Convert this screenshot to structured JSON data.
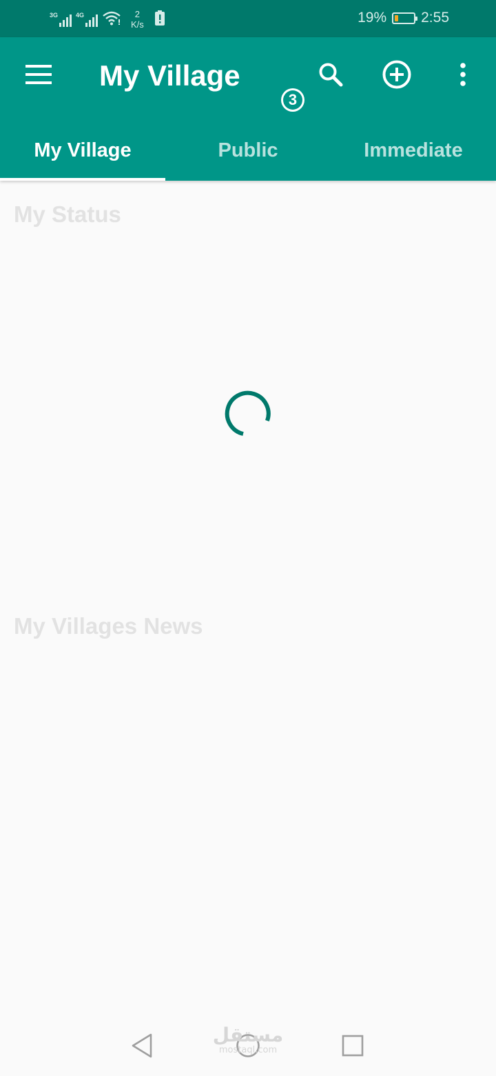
{
  "status_bar": {
    "net1": "3G",
    "net2": "4G",
    "speed_value": "2",
    "speed_unit": "K/s",
    "battery_percent": "19%",
    "battery_level": 0.19,
    "time": "2:55"
  },
  "toolbar": {
    "title": "My Village",
    "menu_icon": "hamburger-menu-icon",
    "search_icon": "search-icon",
    "add_icon": "add-circle-icon",
    "more_icon": "more-vert-icon"
  },
  "tabs": [
    {
      "label": "My Village",
      "active": true
    },
    {
      "label": "Public",
      "active": false,
      "badge": "3"
    },
    {
      "label": "Immediate",
      "active": false
    }
  ],
  "content": {
    "status_heading": "My Status",
    "news_heading": "My Villages News"
  },
  "watermark": {
    "arabic": "مستقل",
    "latin": "mostaql.com"
  },
  "colors": {
    "status_bar": "#00796b",
    "app_bar": "#009688",
    "spinner": "#00796b",
    "background": "#fafafa",
    "battery_fill": "#f5a623"
  }
}
